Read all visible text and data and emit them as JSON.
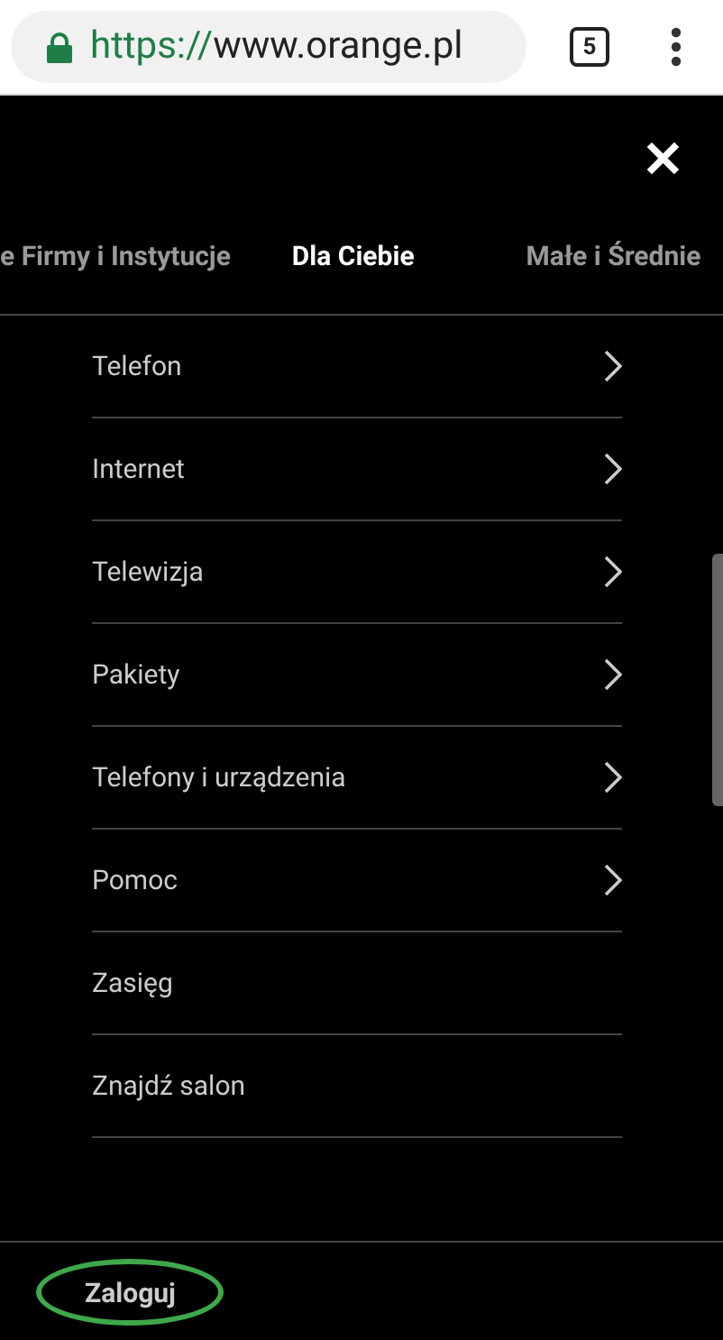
{
  "browser": {
    "url_scheme": "https://",
    "url_host": "www.orange.pl",
    "tab_count": "5"
  },
  "close": {
    "label": "✕"
  },
  "tabs": [
    {
      "label": "e Firmy i Instytucje",
      "selected": false
    },
    {
      "label": "Dla Ciebie",
      "selected": true
    },
    {
      "label": "Małe i Średnie",
      "selected": false
    }
  ],
  "menu": [
    {
      "label": "Telefon",
      "kind": "submenu"
    },
    {
      "label": "Internet",
      "kind": "submenu"
    },
    {
      "label": "Telewizja",
      "kind": "submenu"
    },
    {
      "label": "Pakiety",
      "kind": "submenu"
    },
    {
      "label": "Telefony i urządzenia",
      "kind": "submenu"
    },
    {
      "label": "Pomoc",
      "kind": "submenu"
    },
    {
      "label": "Zasięg",
      "kind": "link"
    },
    {
      "label": "Znajdź salon",
      "kind": "link"
    }
  ],
  "login": {
    "label": "Zaloguj"
  }
}
